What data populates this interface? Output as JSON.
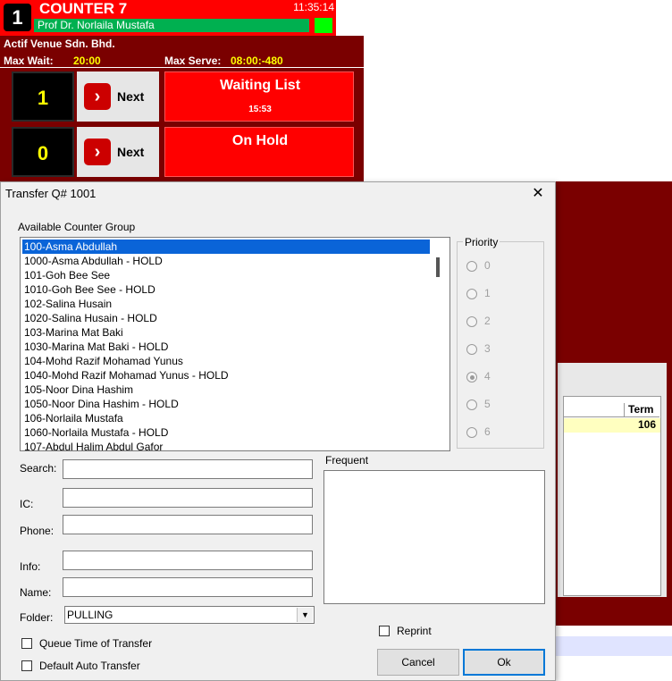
{
  "counter": {
    "number": "1",
    "title": "COUNTER 7",
    "time": "11:35:14",
    "user": "Prof Dr. Norlaila Mustafa"
  },
  "panel": {
    "company": "Actif Venue Sdn. Bhd.",
    "max_wait_label": "Max Wait:",
    "max_wait_value": "20:00",
    "max_serve_label": "Max Serve:",
    "max_serve_value": "08:00:-480",
    "rows": [
      {
        "count": "1",
        "next_label": "Next",
        "list_title": "Waiting List",
        "list_sub": "15:53"
      },
      {
        "count": "0",
        "next_label": "Next",
        "list_title": "On Hold",
        "list_sub": ""
      }
    ],
    "grid": {
      "column_term": "Term",
      "selected_term": "106"
    }
  },
  "dialog": {
    "title": "Transfer Q# 1001",
    "close_glyph": "✕",
    "available_label": "Available Counter Group",
    "items": [
      "100-Asma Abdullah",
      "1000-Asma Abdullah - HOLD",
      "101-Goh Bee See",
      "1010-Goh Bee See - HOLD",
      "102-Salina Husain",
      "1020-Salina Husain - HOLD",
      "103-Marina Mat Baki",
      "1030-Marina Mat Baki - HOLD",
      "104-Mohd Razif Mohamad Yunus",
      "1040-Mohd Razif Mohamad Yunus - HOLD",
      "105-Noor Dina Hashim",
      "1050-Noor Dina Hashim - HOLD",
      "106-Norlaila Mustafa",
      "1060-Norlaila Mustafa - HOLD",
      "107-Abdul Halim Abdul Gafor"
    ],
    "priority_label": "Priority",
    "priorities": [
      "0",
      "1",
      "2",
      "3",
      "4",
      "5",
      "6"
    ],
    "selected_priority": "4",
    "fields": {
      "search_label": "Search:",
      "ic_label": "IC:",
      "phone_label": "Phone:",
      "info_label": "Info:",
      "name_label": "Name:",
      "folder_label": "Folder:",
      "folder_value": "PULLING"
    },
    "frequent_label": "Frequent",
    "queue_time_label": "Queue Time of Transfer",
    "default_auto_label": "Default Auto Transfer",
    "reprint_label": "Reprint",
    "cancel_label": "Cancel",
    "ok_label": "Ok",
    "dropdown_glyph": "▼"
  }
}
